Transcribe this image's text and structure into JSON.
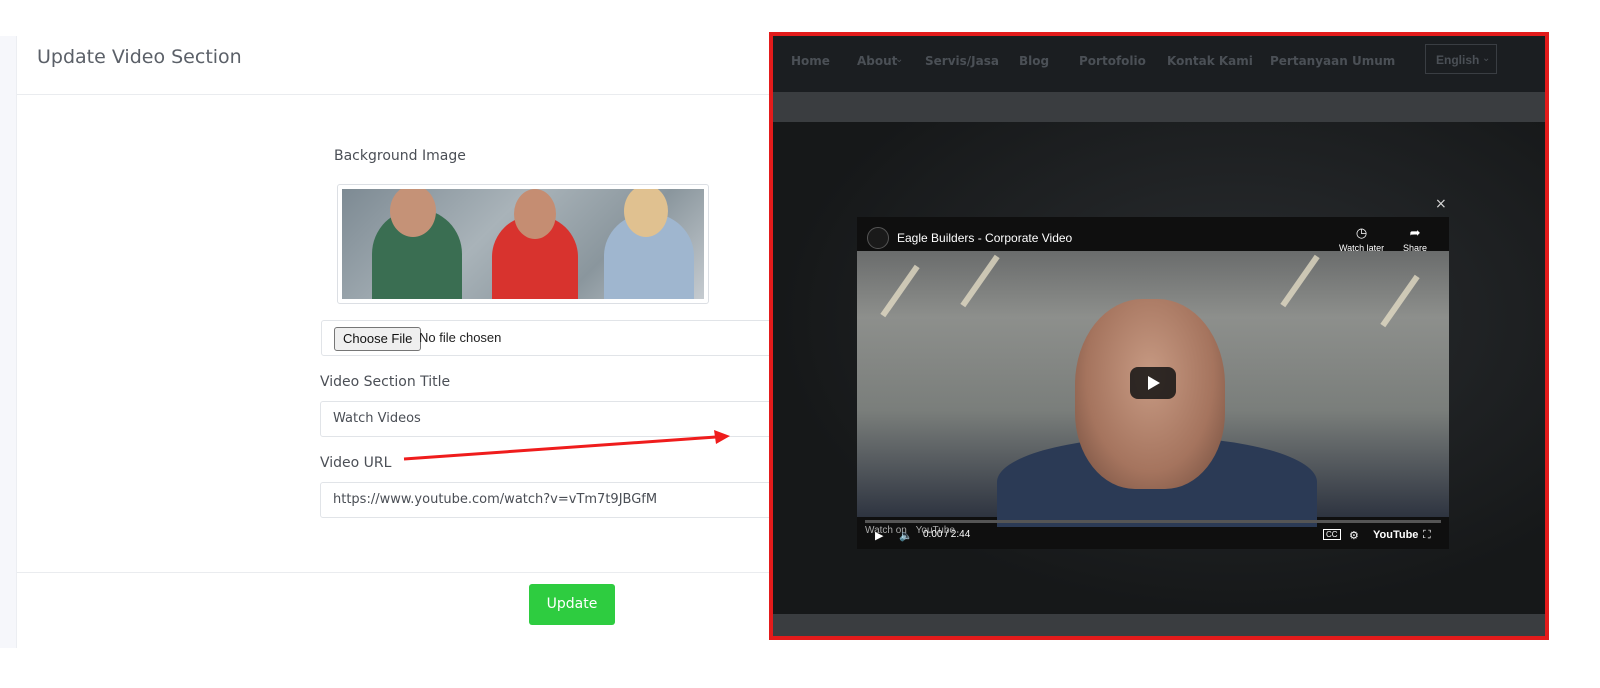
{
  "admin": {
    "card_title": "Update Video Section",
    "background_image_label": "Background Image",
    "file_input": {
      "button_label": "Choose File",
      "status_text": "No file chosen"
    },
    "video_title_label": "Video Section Title",
    "video_title_value": "Watch Videos",
    "video_url_label": "Video URL",
    "video_url_value": "https://www.youtube.com/watch?v=vTm7t9JBGfM",
    "update_button": "Update",
    "accent_color": "#2ecc40"
  },
  "preview": {
    "border_color": "#e31b1b",
    "nav": {
      "items": [
        "Home",
        "About",
        "Servis/Jasa",
        "Blog",
        "Portofolio",
        "Kontak Kami",
        "Pertanyaan Umum"
      ],
      "language": "English"
    },
    "modal_close": "×",
    "video": {
      "title": "Eagle Builders - Corporate Video",
      "watch_later": "Watch later",
      "share": "Share",
      "watch_on": "Watch on",
      "youtube_small": "YouTube",
      "time": "0:00 / 2:44",
      "youtube_logo": "YouTube",
      "cc": "CC"
    }
  }
}
